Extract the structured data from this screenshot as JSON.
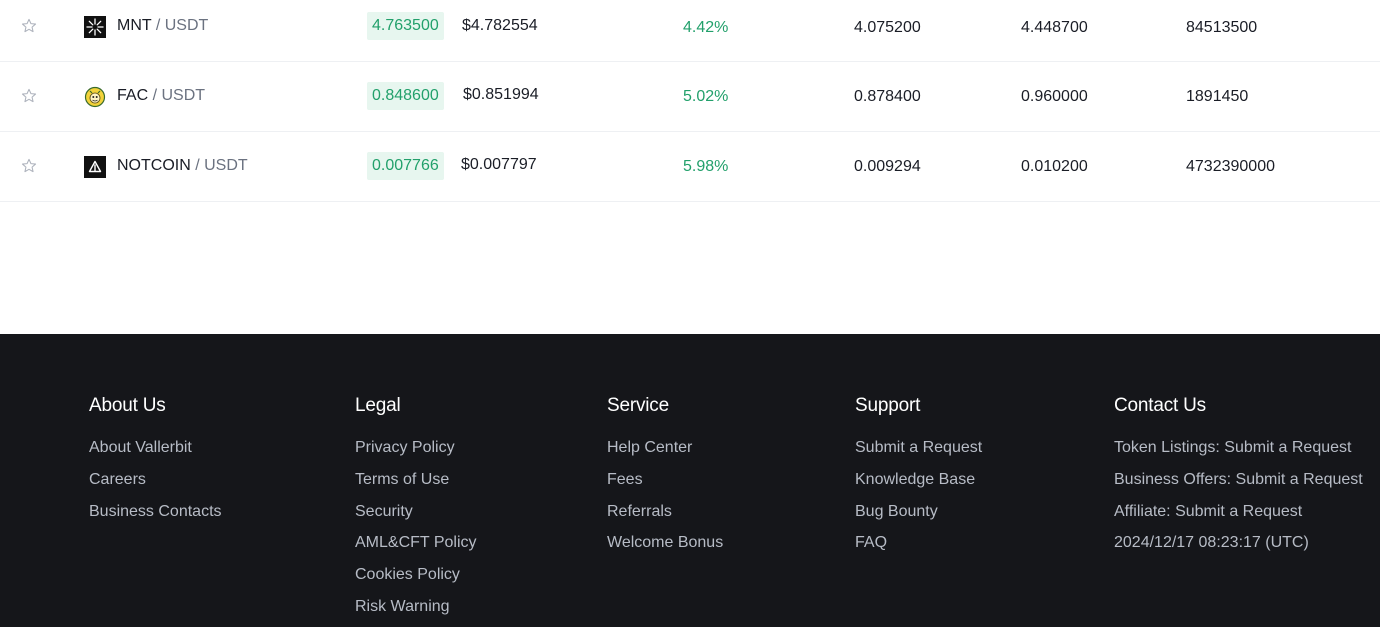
{
  "market": {
    "rows": [
      {
        "icon": "mnt-logo-icon",
        "base": "MNT",
        "separator": " / ",
        "quote": "USDT",
        "price": "4.763500",
        "usd_price": "$4.782554",
        "change": "4.42%",
        "low": "4.075200",
        "high": "4.448700",
        "volume": "84513500"
      },
      {
        "icon": "fac-logo-icon",
        "base": "FAC",
        "separator": " / ",
        "quote": "USDT",
        "price": "0.848600",
        "usd_price": "$0.851994",
        "change": "5.02%",
        "low": "0.878400",
        "high": "0.960000",
        "volume": "1891450"
      },
      {
        "icon": "notcoin-logo-icon",
        "base": "NOTCOIN",
        "separator": " / ",
        "quote": "USDT",
        "price": "0.007766",
        "usd_price": "$0.007797",
        "change": "5.98%",
        "low": "0.009294",
        "high": "0.010200",
        "volume": "4732390000"
      }
    ],
    "colors": {
      "positive": "#22a06b",
      "positive_bg": "#e7f6ef"
    }
  },
  "footer": {
    "about": {
      "title": "About Us",
      "links": [
        "About Vallerbit",
        "Careers",
        "Business Contacts"
      ]
    },
    "legal": {
      "title": "Legal",
      "links": [
        "Privacy Policy",
        "Terms of Use",
        "Security",
        "AML&CFT Policy",
        "Cookies Policy",
        "Risk Warning"
      ]
    },
    "service": {
      "title": "Service",
      "links": [
        "Help Center",
        "Fees",
        "Referrals",
        "Welcome Bonus"
      ]
    },
    "support": {
      "title": "Support",
      "links": [
        "Submit a Request",
        "Knowledge Base",
        "Bug Bounty",
        "FAQ"
      ]
    },
    "contact": {
      "title": "Contact Us",
      "links": [
        "Token Listings: Submit a Request",
        "Business Offers: Submit a Request",
        "Affiliate: Submit a Request"
      ],
      "timestamp": "2024/12/17 08:23:17 (UTC)"
    },
    "colors": {
      "background": "#15161a",
      "heading": "#ffffff",
      "link": "#b7bcc6"
    }
  }
}
